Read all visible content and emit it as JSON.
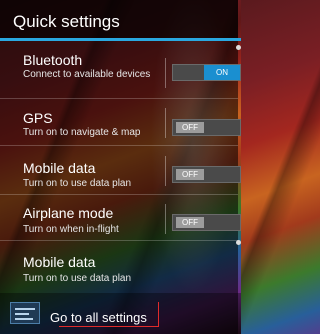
{
  "header": {
    "title": "Quick settings"
  },
  "rows": [
    {
      "title": "Bluetooth",
      "subtitle": "Connect to available devices",
      "toggle": "ON"
    },
    {
      "title": "GPS",
      "subtitle": "Turn on to navigate & map",
      "toggle": "OFF"
    },
    {
      "title": "Mobile data",
      "subtitle": "Turn on to use data plan",
      "toggle": "OFF"
    },
    {
      "title": "Airplane mode",
      "subtitle": "Turn on when in-flight",
      "toggle": "OFF"
    },
    {
      "title": "Mobile data",
      "subtitle": "Turn on to use data plan"
    }
  ],
  "footer": {
    "label": "Go to all settings",
    "icon": "settings-sliders-icon"
  },
  "colors": {
    "accent": "#2aa8e0",
    "toggle_on": "#1a8fd0",
    "callout": "#e02b2b"
  }
}
